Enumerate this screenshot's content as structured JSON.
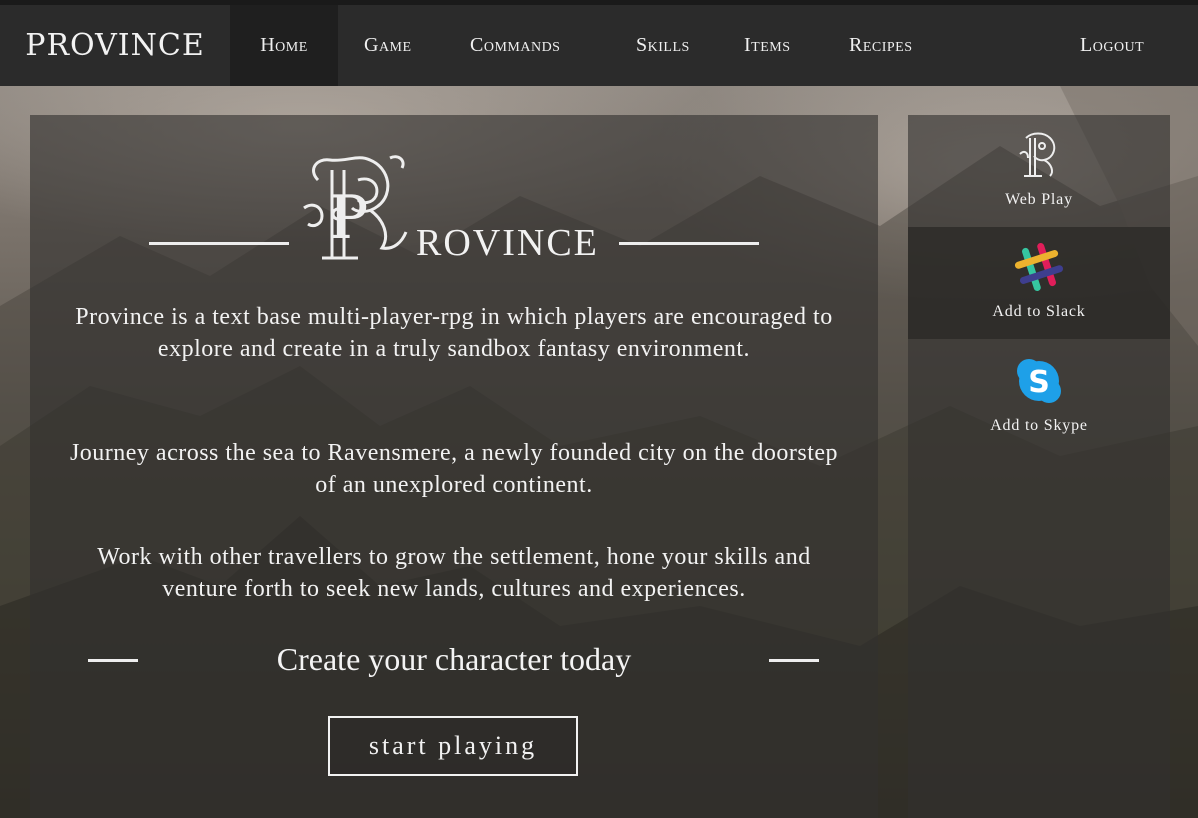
{
  "navbar": {
    "brand": "PROVINCE",
    "items": [
      {
        "label": "Home",
        "active": true
      },
      {
        "label": "Game"
      },
      {
        "label": "Commands"
      },
      {
        "label": "Skills"
      },
      {
        "label": "Items"
      },
      {
        "label": "Recipes"
      }
    ],
    "logout": "Logout"
  },
  "main": {
    "logo_initial": "P",
    "logo_text": "ROVINCE",
    "paragraphs": [
      "Province is a text base multi-player-rpg in which players are encouraged to explore and create in a truly sandbox fantasy environment.",
      "Journey across the sea to Ravensmere, a newly founded city on the doorstep of an unexplored continent.",
      "Work with other travellers to grow the settlement, hone your skills and venture forth to seek new lands, cultures and experiences."
    ],
    "cta": "Create your character today",
    "start_button": "start playing"
  },
  "side": {
    "items": [
      {
        "label": "Web Play",
        "icon": "province-p-icon"
      },
      {
        "label": "Add to Slack",
        "icon": "slack-icon"
      },
      {
        "label": "Add to Skype",
        "icon": "skype-icon"
      }
    ]
  },
  "colors": {
    "navbar_bg": "#2b2b2b",
    "active_nav_bg": "#1f1f1f",
    "text": "#f2f2f2",
    "skype_blue": "#1ea0e8"
  }
}
